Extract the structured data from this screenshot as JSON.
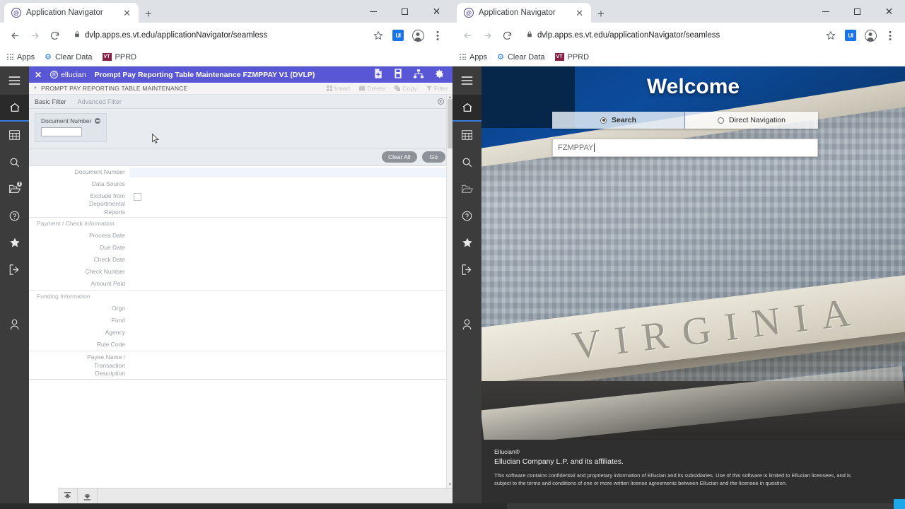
{
  "left_window": {
    "tab": {
      "title": "Application Navigator",
      "favicon": "ellucian-favicon",
      "close": "✕"
    },
    "newtab_label": "+",
    "controls": {
      "minimize": "minimize-icon",
      "maximize": "maximize-icon",
      "close": "✕"
    },
    "omnibox": {
      "url": "dvlp.apps.es.vt.edu/applicationNavigator/seamless",
      "lock": "🔒"
    },
    "bookmarks": [
      {
        "label": "Apps",
        "icon": "apps-grid-icon"
      },
      {
        "label": "Clear Data",
        "icon": "gear-icon"
      },
      {
        "label": "PPRD",
        "icon": "pprd-icon"
      }
    ],
    "app": {
      "header": {
        "close": "✕",
        "brand": "ellucian",
        "title": "Prompt Pay Reporting Table Maintenance FZMPPAY V1 (DVLP)",
        "icons": [
          "add-page-icon",
          "save-icon",
          "related-sitemap-icon",
          "tools-gear-icon"
        ]
      },
      "breadcrumb": "PROMPT PAY REPORTING TABLE MAINTENANCE",
      "record_actions": [
        {
          "label": "Insert",
          "icon": "insert-icon"
        },
        {
          "label": "Delete",
          "icon": "delete-icon"
        },
        {
          "label": "Copy",
          "icon": "copy-icon"
        },
        {
          "label": "Filter",
          "icon": "filter-icon"
        }
      ],
      "filter_tabs": [
        {
          "label": "Basic Filter",
          "active": true
        },
        {
          "label": "Advanced Filter",
          "active": false
        }
      ],
      "filter_chips": [
        {
          "label": "Document Number",
          "value": ""
        }
      ],
      "buttons": {
        "clear_all": "Clear All",
        "go": "Go"
      },
      "form_sections": [
        {
          "section_label": "",
          "fields": [
            {
              "label": "Document Number",
              "type": "text",
              "value": "",
              "highlight": true
            },
            {
              "label": "Data Source",
              "type": "text",
              "value": ""
            },
            {
              "label": "Exclude from Departmental Reports",
              "type": "checkbox",
              "checked": false
            }
          ]
        },
        {
          "section_label": "Payment / Check Information",
          "fields": [
            {
              "label": "Process Date",
              "type": "text",
              "value": ""
            },
            {
              "label": "Due Date",
              "type": "text",
              "value": ""
            },
            {
              "label": "Check Date",
              "type": "text",
              "value": ""
            },
            {
              "label": "Check Number",
              "type": "text",
              "value": ""
            },
            {
              "label": "Amount Paid",
              "type": "text",
              "value": ""
            }
          ]
        },
        {
          "section_label": "Funding Information",
          "fields": [
            {
              "label": "Orgn",
              "type": "text",
              "value": ""
            },
            {
              "label": "Fund",
              "type": "text",
              "value": ""
            },
            {
              "label": "Agency",
              "type": "text",
              "value": ""
            },
            {
              "label": "Rule Code",
              "type": "text",
              "value": ""
            }
          ]
        },
        {
          "section_label": "",
          "fields": [
            {
              "label": "Payee Name / Transaction Description",
              "type": "text",
              "value": ""
            }
          ]
        }
      ],
      "bottom_bar": [
        {
          "icon": "go-to-top-icon"
        },
        {
          "icon": "go-to-bottom-icon"
        }
      ]
    },
    "rail": [
      {
        "name": "menu-hamburger",
        "badge": ""
      },
      {
        "name": "home",
        "badge": "",
        "active": true
      },
      {
        "name": "applications-grid",
        "badge": ""
      },
      {
        "name": "search",
        "badge": ""
      },
      {
        "name": "recently-opened-folder",
        "badge": "1"
      },
      {
        "name": "help",
        "badge": ""
      },
      {
        "name": "favorites-star",
        "badge": ""
      },
      {
        "name": "sign-out",
        "badge": ""
      },
      {
        "name": "my-banner-user",
        "badge": ""
      }
    ]
  },
  "right_window": {
    "tab": {
      "title": "Application Navigator",
      "favicon": "ellucian-favicon",
      "close": "✕"
    },
    "newtab_label": "+",
    "controls": {
      "minimize": "minimize-icon",
      "maximize": "maximize-icon",
      "close": "✕"
    },
    "omnibox": {
      "url": "dvlp.apps.es.vt.edu/applicationNavigator/seamless",
      "lock": "🔒"
    },
    "bookmarks": [
      {
        "label": "Apps",
        "icon": "apps-grid-icon"
      },
      {
        "label": "Clear Data",
        "icon": "gear-icon"
      },
      {
        "label": "PPRD",
        "icon": "pprd-icon"
      }
    ],
    "welcome": {
      "title": "Welcome",
      "segments": [
        {
          "label": "Search",
          "selected": true
        },
        {
          "label": "Direct Navigation",
          "selected": false
        }
      ],
      "search_value": "FZMPPAY",
      "background_engraving": "VIRGINIA"
    },
    "footer": {
      "brand": "Ellucian®",
      "company": "Ellucian Company L.P. and its affiliates.",
      "legal": "This software contains confidential and proprietary information of Ellucian and its subsidiaries. Use of this software is limited to Ellucian licensees, and is subject to the terms and conditions of one or more written license agreements between Ellucian and the licensee in question."
    },
    "rail": [
      {
        "name": "menu-hamburger",
        "badge": ""
      },
      {
        "name": "home",
        "badge": "",
        "active": true
      },
      {
        "name": "applications-grid",
        "badge": ""
      },
      {
        "name": "search",
        "badge": ""
      },
      {
        "name": "recently-opened-folder",
        "badge": ""
      },
      {
        "name": "help",
        "badge": ""
      },
      {
        "name": "favorites-star",
        "badge": ""
      },
      {
        "name": "sign-out",
        "badge": ""
      },
      {
        "name": "my-banner-user",
        "badge": ""
      }
    ]
  },
  "colors": {
    "app_header_purple": "#5a57d6",
    "rail_dark": "#3c3c3c",
    "filter_bg": "#e8ebef",
    "taskbar_accent": "#1ea7e8",
    "chrome_tabstrip": "#dee1e6"
  }
}
